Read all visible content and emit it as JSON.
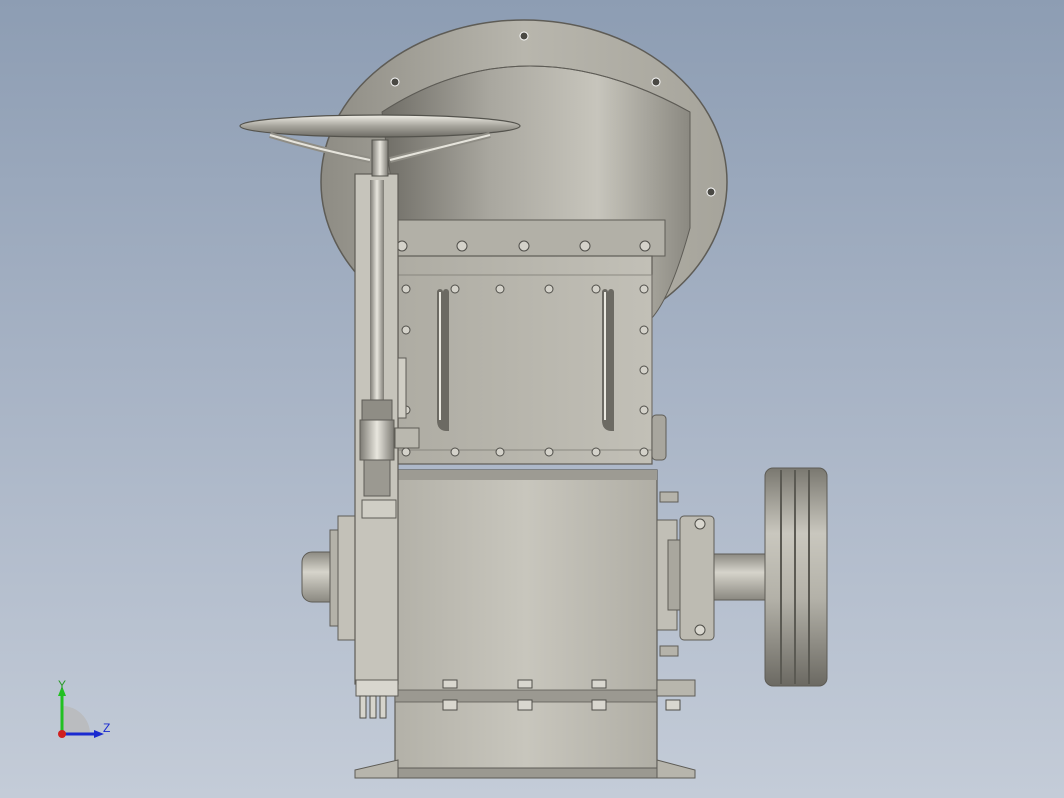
{
  "viewport": {
    "background_top": "#8d9db3",
    "background_bottom": "#c4ccd8"
  },
  "model": {
    "parts": [
      "handwheel",
      "valve-stem",
      "inlet-flange",
      "hopper",
      "gate-box",
      "crusher-housing",
      "bearing-housing",
      "shaft",
      "v-belt-pulley",
      "base"
    ],
    "metal_color": "#c4c4ba"
  },
  "triad": {
    "y_label": "Y",
    "z_label": "Z",
    "y_color": "#22c022",
    "z_color": "#1a2ad0",
    "x_color": "#d02020"
  }
}
